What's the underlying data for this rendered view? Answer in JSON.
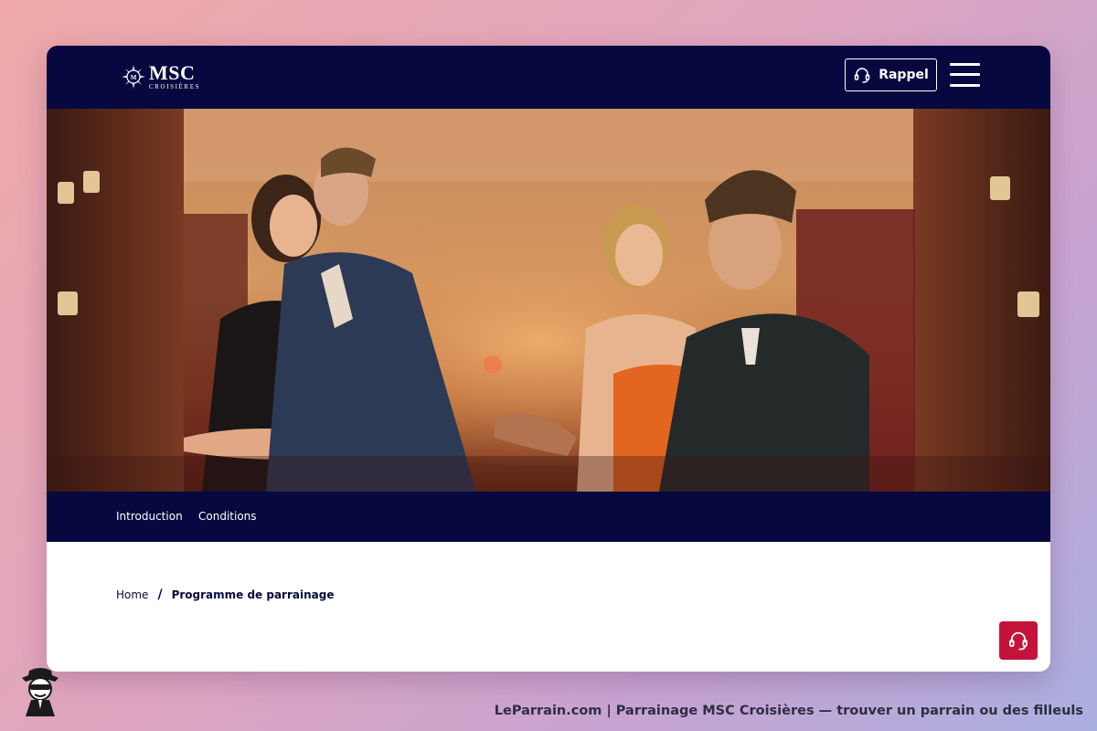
{
  "header": {
    "logo_text": "MSC",
    "logo_subtext": "CROISIÈRES",
    "rappel_label": "Rappel"
  },
  "hero": {
    "image": "photo-two-couples-laughing-in-ship-lounge"
  },
  "subnav": {
    "items": [
      {
        "label": "Introduction"
      },
      {
        "label": "Conditions"
      }
    ]
  },
  "breadcrumb": {
    "home": "Home",
    "separator": "/",
    "current": "Programme de parrainage"
  },
  "footer": {
    "caption": "LeParrain.com | Parrainage MSC Croisières — trouver un parrain ou des filleuls"
  },
  "colors": {
    "navy": "#06083f",
    "support_red": "#c4133a"
  },
  "icons": {
    "logo": "msc-compass-logo-icon",
    "rappel": "headset-icon",
    "menu": "hamburger-menu-icon",
    "support": "headset-icon",
    "mascot": "detective-mascot-icon"
  }
}
